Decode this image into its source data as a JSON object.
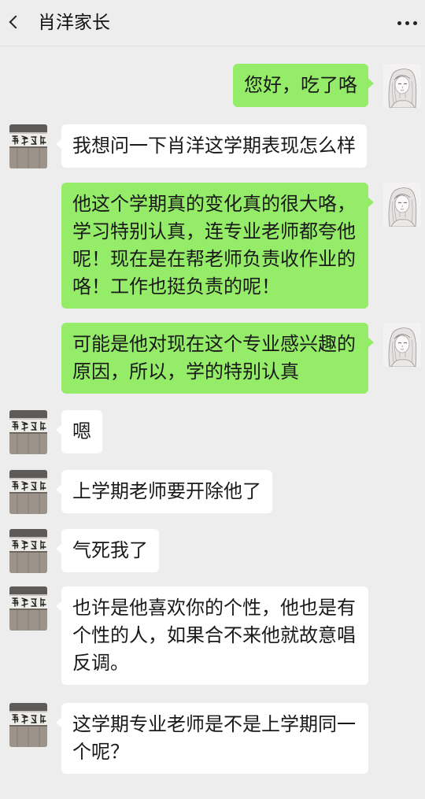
{
  "header": {
    "title": "肖洋家长",
    "back_icon": "chevron-left-icon",
    "more_icon": "more-dots-icon"
  },
  "colors": {
    "background": "#ededed",
    "sent_bubble": "#95ec69",
    "received_bubble": "#ffffff",
    "text": "#191919"
  },
  "avatars": {
    "self": "sketch-portrait-avatar",
    "contact": "calligraphy-plaque-avatar"
  },
  "messages": [
    {
      "outgoing": true,
      "text": "您好，吃了咯"
    },
    {
      "outgoing": false,
      "text": "我想问一下肖洋这学期表现怎么样"
    },
    {
      "outgoing": true,
      "text": "他这个学期真的变化真的很大咯，学习特别认真，连专业老师都夸他呢！现在是在帮老师负责收作业的咯！工作也挺负责的呢！"
    },
    {
      "outgoing": true,
      "text": "可能是他对现在这个专业感兴趣的原因，所以，学的特别认真"
    },
    {
      "outgoing": false,
      "text": "嗯"
    },
    {
      "outgoing": false,
      "text": "上学期老师要开除他了"
    },
    {
      "outgoing": false,
      "text": "气死我了"
    },
    {
      "outgoing": false,
      "text": "也许是他喜欢你的个性，他也是有个性的人，如果合不来他就故意唱反调。"
    },
    {
      "outgoing": false,
      "text": "这学期专业老师是不是上学期同一个呢？"
    }
  ]
}
